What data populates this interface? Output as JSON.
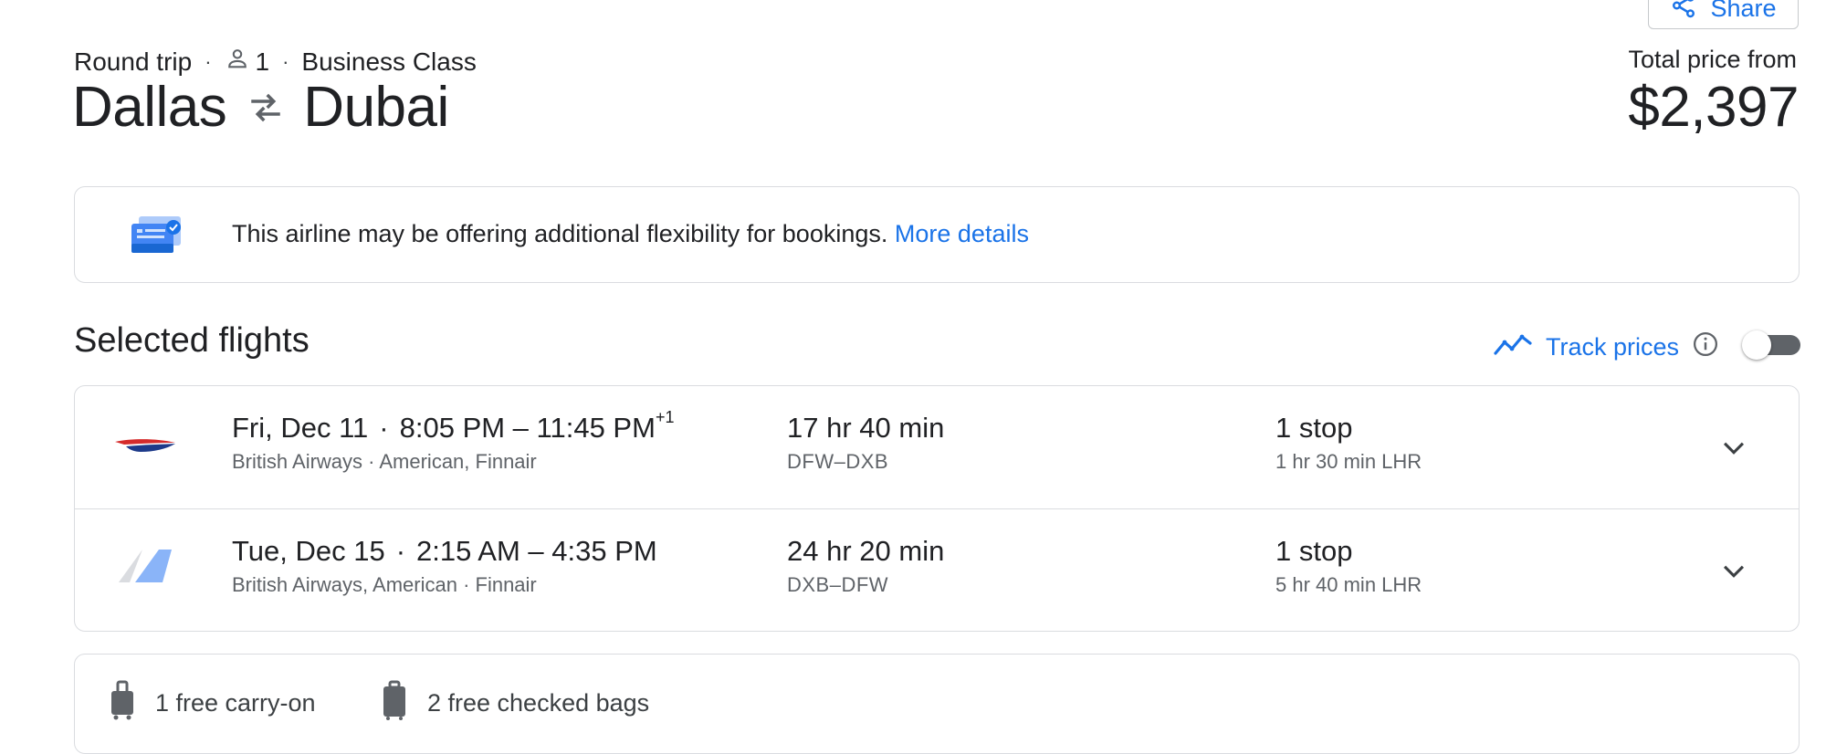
{
  "header": {
    "share_label": "Share",
    "trip_type": "Round trip",
    "passengers": "1",
    "cabin_class": "Business Class",
    "origin": "Dallas",
    "destination": "Dubai",
    "total_label": "Total price from",
    "total_price": "$2,397"
  },
  "banner": {
    "text": "This airline may be offering additional flexibility for bookings.",
    "link": "More details"
  },
  "selected": {
    "title": "Selected flights",
    "track_label": "Track prices",
    "track_enabled": false
  },
  "flights": [
    {
      "date": "Fri, Dec 11",
      "time_range": "8:05 PM – 11:45 PM",
      "day_offset": "+1",
      "airlines": "British Airways · American, Finnair",
      "duration": "17 hr 40 min",
      "route": "DFW–DXB",
      "stops": "1 stop",
      "layover": "1 hr 30 min LHR"
    },
    {
      "date": "Tue, Dec 15",
      "time_range": "2:15 AM – 4:35 PM",
      "day_offset": "",
      "airlines": "British Airways, American · Finnair",
      "duration": "24 hr 20 min",
      "route": "DXB–DFW",
      "stops": "1 stop",
      "layover": "5 hr 40 min LHR"
    }
  ],
  "bags": {
    "carry_on": "1 free carry-on",
    "checked": "2 free checked bags"
  },
  "colors": {
    "accent": "#1a73e8",
    "text": "#202124",
    "secondary_text": "#5f6368",
    "border": "#dadce0"
  },
  "icons": {
    "share": "share-icon",
    "person": "person-icon",
    "swap": "swap-arrows-icon",
    "banner": "ticket-check-icon",
    "track": "trend-line-icon",
    "info": "info-icon",
    "expand": "chevron-down-icon",
    "carry_on": "carry-on-bag-icon",
    "checked": "checked-bag-icon"
  }
}
